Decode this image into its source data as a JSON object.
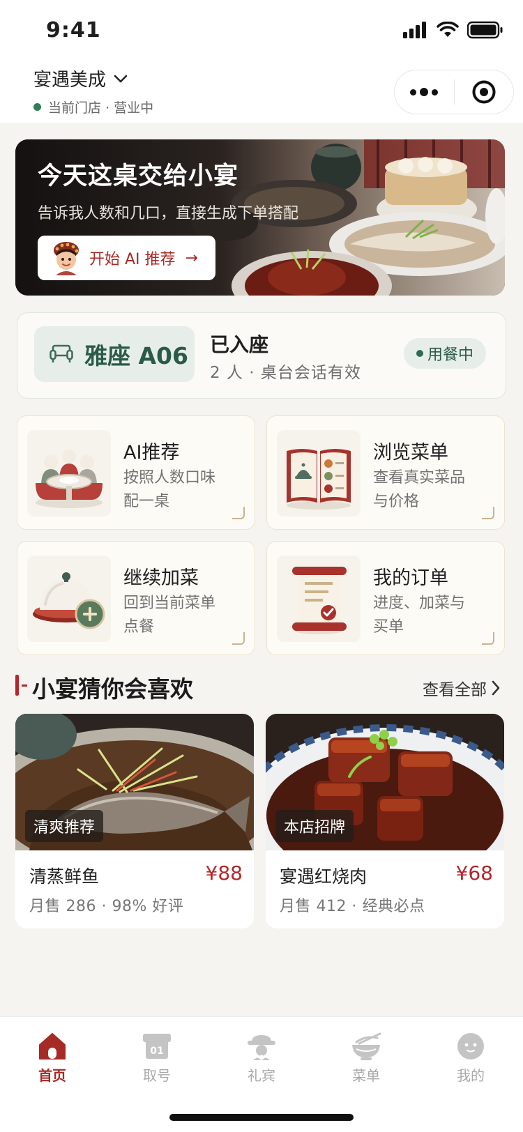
{
  "status_bar": {
    "time": "9:41"
  },
  "header": {
    "store_name": "宴遇美成",
    "store_status": "当前门店 · 营业中"
  },
  "hero": {
    "title": "今天这桌交给小宴",
    "subtitle": "告诉我人数和几口，直接生成下单搭配",
    "button_label": "开始 AI 推荐",
    "button_arrow": "→"
  },
  "table": {
    "seat": "雅座 A06",
    "state": "已入座",
    "info": "2 人 · 桌台会话有效",
    "badge": "用餐中"
  },
  "tiles": [
    {
      "title": "AI推荐",
      "desc": "按照人数口味配一桌",
      "icon": "banquet-table-icon"
    },
    {
      "title": "浏览菜单",
      "desc": "查看真实菜品与价格",
      "icon": "menu-book-icon"
    },
    {
      "title": "继续加菜",
      "desc": "回到当前菜单点餐",
      "icon": "dish-cover-add-icon"
    },
    {
      "title": "我的订单",
      "desc": "进度、加菜与买单",
      "icon": "order-scroll-icon"
    }
  ],
  "section": {
    "title": "小宴猜你会喜欢",
    "more": "查看全部"
  },
  "dishes": [
    {
      "tag": "清爽推荐",
      "name": "清蒸鲜鱼",
      "price": "¥88",
      "meta": "月售 286 · 98% 好评"
    },
    {
      "tag": "本店招牌",
      "name": "宴遇红烧肉",
      "price": "¥68",
      "meta": "月售 412 · 经典必点"
    }
  ],
  "tabbar": [
    {
      "label": "首页",
      "icon": "home-icon",
      "active": true
    },
    {
      "label": "取号",
      "icon": "queue-ticket-icon",
      "active": false
    },
    {
      "label": "礼宾",
      "icon": "concierge-icon",
      "active": false
    },
    {
      "label": "菜单",
      "icon": "bowl-icon",
      "active": false
    },
    {
      "label": "我的",
      "icon": "profile-icon",
      "active": false
    }
  ],
  "colors": {
    "accent_red": "#a62a25",
    "jade": "#2a5a48",
    "background": "#f5f4f1"
  }
}
